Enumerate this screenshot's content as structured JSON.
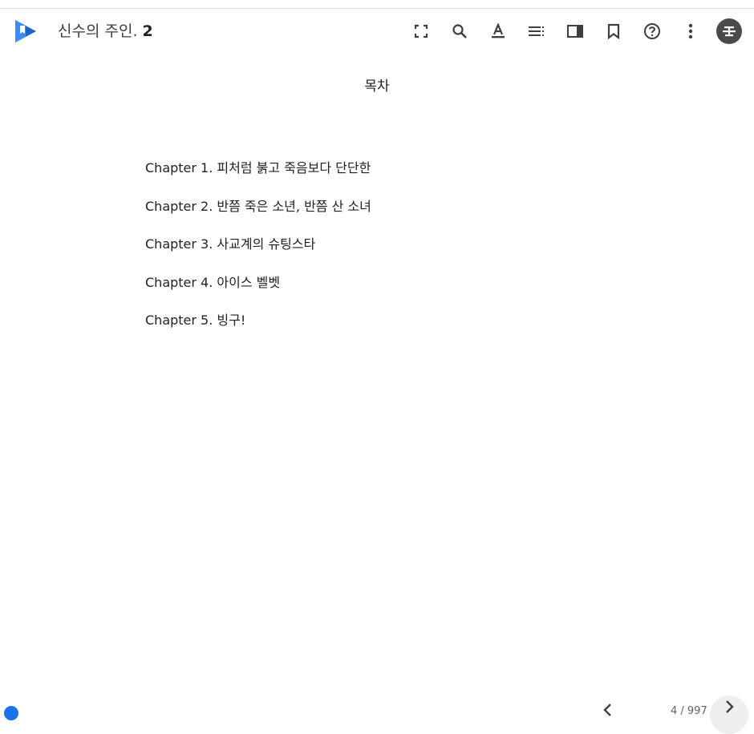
{
  "header": {
    "book_title": "신수의 주인.",
    "book_volume": "2",
    "toolbar": [
      {
        "name": "fullscreen-icon"
      },
      {
        "name": "search-icon"
      },
      {
        "name": "text-format-icon"
      },
      {
        "name": "table-of-contents-icon"
      },
      {
        "name": "reading-mode-icon"
      },
      {
        "name": "bookmark-icon"
      },
      {
        "name": "help-icon"
      },
      {
        "name": "more-options-icon"
      }
    ],
    "avatar_icon": "account-avatar-icon"
  },
  "content": {
    "toc_title": "목차",
    "chapters": [
      "Chapter 1. 피처럼 붉고 죽음보다 단단한",
      "Chapter 2. 반쯤 죽은 소년, 반쯤 산 소녀",
      "Chapter 3. 사교계의 슈팅스타",
      "Chapter 4. 아이스 벨벳",
      "Chapter 5. 빙구!"
    ]
  },
  "footer": {
    "page_indicator": "4 / 997",
    "progress_fraction": 0.004
  },
  "colors": {
    "accent": "#1a73e8",
    "icon": "#5f6368",
    "text": "#202124",
    "avatar_bg": "#4a4a4a"
  }
}
